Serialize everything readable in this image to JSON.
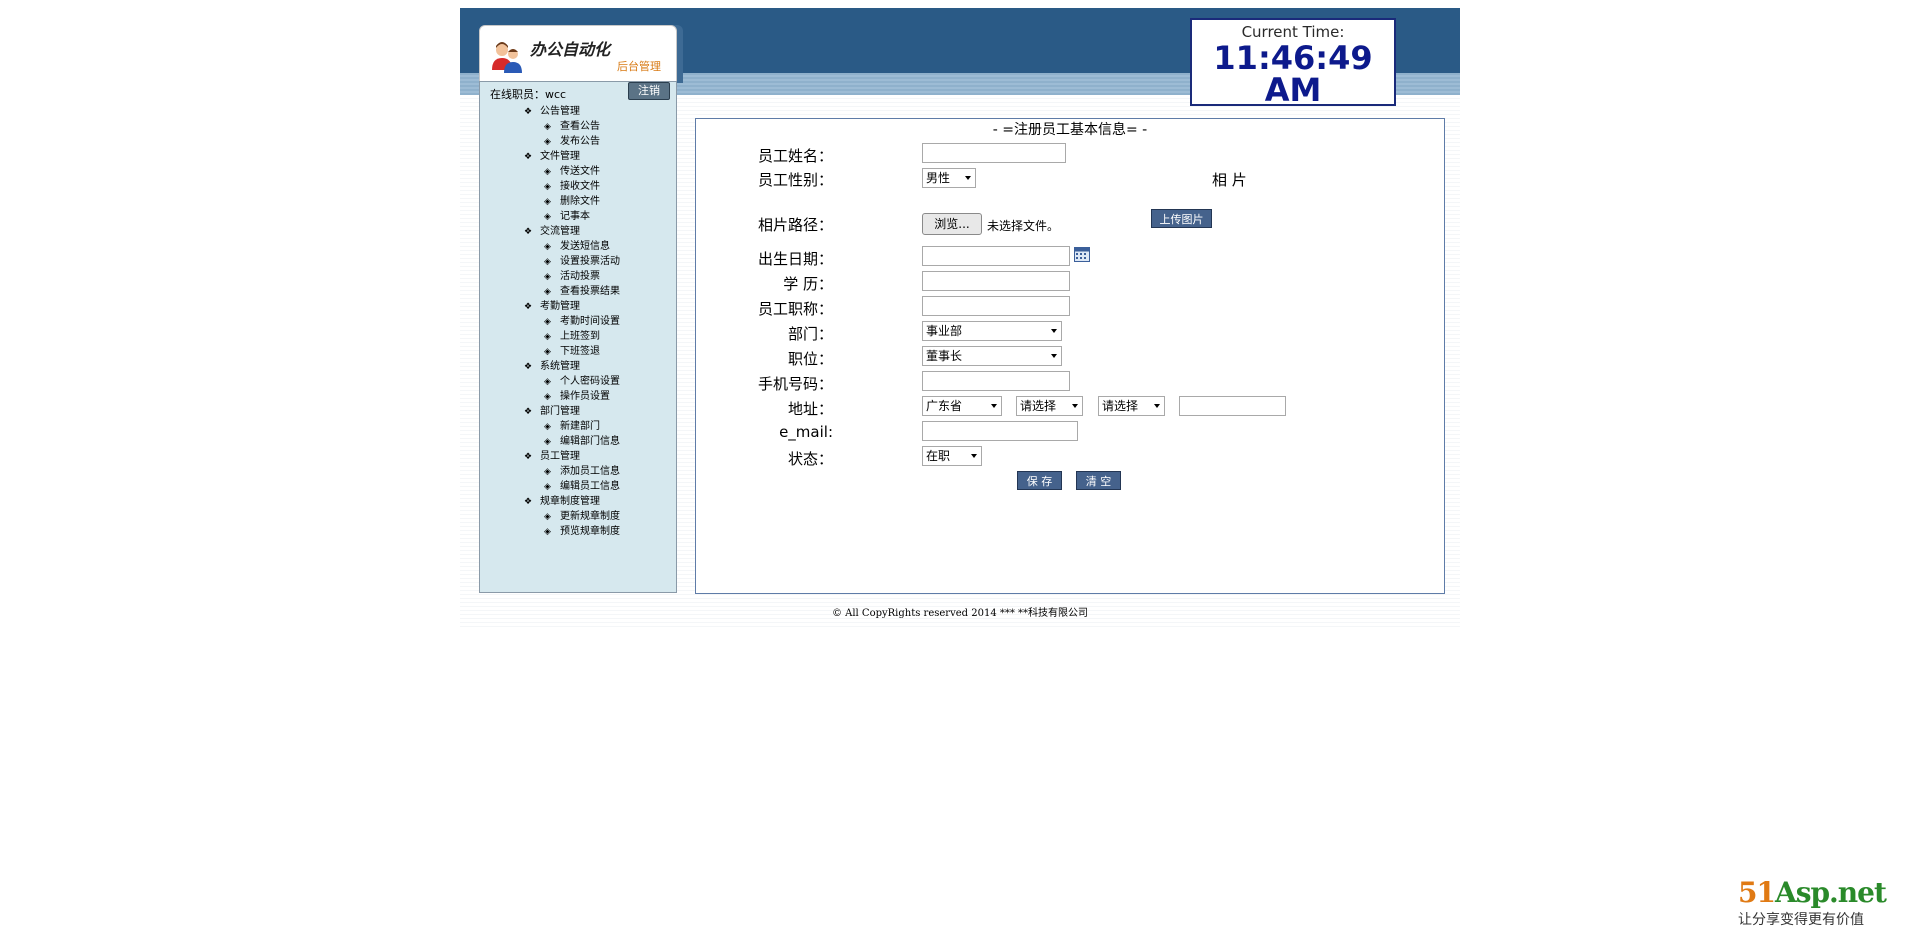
{
  "header": {
    "logo_title": "办公自动化",
    "logo_subtitle": "后台管理",
    "clock_label": "Current Time:",
    "clock_time": "11:46:49",
    "clock_ampm": "AM"
  },
  "sidebar": {
    "online_user": "在线职员：wcc",
    "logout_label": "注销",
    "bullet": "❖",
    "sub_bullet": "◈",
    "groups": [
      {
        "label": "公告管理",
        "items": [
          "查看公告",
          "发布公告"
        ]
      },
      {
        "label": "文件管理",
        "items": [
          "传送文件",
          "接收文件",
          "删除文件",
          "记事本"
        ]
      },
      {
        "label": "交流管理",
        "items": [
          "发送短信息",
          "设置投票活动",
          "活动投票",
          "查看投票结果"
        ]
      },
      {
        "label": "考勤管理",
        "items": [
          "考勤时间设置",
          "上班签到",
          "下班签退"
        ]
      },
      {
        "label": "系统管理",
        "items": [
          "个人密码设置",
          "操作员设置"
        ]
      },
      {
        "label": "部门管理",
        "items": [
          "新建部门",
          "编辑部门信息"
        ]
      },
      {
        "label": "员工管理",
        "items": [
          "添加员工信息",
          "编辑员工信息"
        ]
      },
      {
        "label": "规章制度管理",
        "items": [
          "更新规章制度",
          "预览规章制度"
        ]
      }
    ]
  },
  "form": {
    "title": "- =注册员工基本信息= -",
    "name_label": "员工姓名：",
    "name_value": "",
    "gender_label": "员工性别：",
    "gender_value": "男性",
    "photo_label": "相 片",
    "photo_path_label": "相片路径：",
    "browse_label": "浏览...",
    "no_file_text": "未选择文件。",
    "upload_label": "上传图片",
    "birth_label": "出生日期：",
    "birth_value": "",
    "edu_label": "学 历：",
    "edu_value": "",
    "title_label": "员工职称：",
    "title_value": "",
    "dept_label": "部门：",
    "dept_value": "事业部",
    "position_label": "职位：",
    "position_value": "董事长",
    "mobile_label": "手机号码：",
    "mobile_value": "",
    "address_label": "地址：",
    "province_value": "广东省",
    "city_value": "请选择",
    "district_value": "请选择",
    "address_detail_value": "",
    "email_label": "e_mail:",
    "email_value": "",
    "status_label": "状态：",
    "status_value": "在职",
    "save_label": "保 存",
    "clear_label": "清 空"
  },
  "footer": {
    "text": "© All CopyRights reserved  2014  *** **科技有限公司"
  },
  "brand": {
    "name_num": "51",
    "name_rest": "Asp.net",
    "slogan": "让分享变得更有价值",
    "num_color": "#e07a14",
    "rest_color": "#2a8a2a"
  }
}
